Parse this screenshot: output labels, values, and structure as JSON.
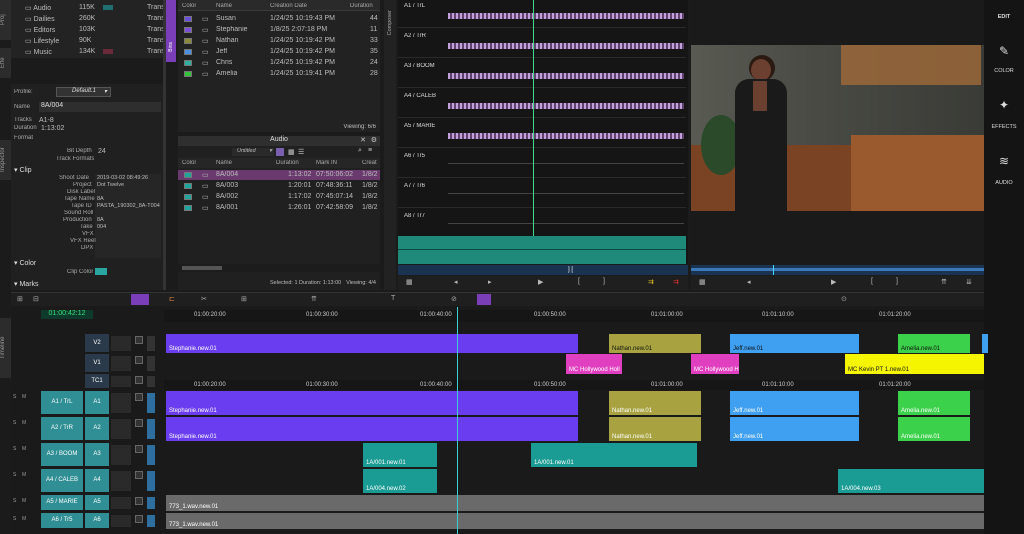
{
  "bins": {
    "items": [
      {
        "name": "Audio",
        "size": "115K",
        "type": "Trans"
      },
      {
        "name": "Dailies",
        "size": "260K",
        "type": "Trans"
      },
      {
        "name": "Editors",
        "size": "103K",
        "type": "Trans"
      },
      {
        "name": "Lifestyle",
        "size": "90K",
        "type": "Trans"
      },
      {
        "name": "Music",
        "size": "134K",
        "type": "Trans"
      }
    ]
  },
  "side_tabs": {
    "project": "Proj",
    "effects": "Effe",
    "inspector": "Inspector",
    "bins": "Bins",
    "composer": "Composer",
    "timeline": "Timeline"
  },
  "inspector": {
    "profile_label": "Profile:",
    "profile_value": "Default.1",
    "name_label": "Name",
    "name": "8A/004",
    "tracks_label": "Tracks",
    "tracks": "A1-8",
    "duration_label": "Duration",
    "duration": "1:13:02",
    "format_label": "Format",
    "bit_depth_label": "Bit Depth",
    "bit_depth": "24",
    "track_formats_label": "Track Formats",
    "clip_section": "Clip",
    "fields": [
      {
        "label": "Shoot Date",
        "value": "2019-03-02 08:49:26"
      },
      {
        "label": "Project",
        "value": "Dot Twelve"
      },
      {
        "label": "Disk Label",
        "value": ""
      },
      {
        "label": "Tape Name",
        "value": "8A"
      },
      {
        "label": "Tape ID",
        "value": "PASTA_190302_8A-T004"
      },
      {
        "label": "Sound Roll",
        "value": ""
      },
      {
        "label": "Production",
        "value": "8A"
      },
      {
        "label": "Take",
        "value": "004"
      },
      {
        "label": "VFX",
        "value": ""
      },
      {
        "label": "VFX Reel",
        "value": ""
      },
      {
        "label": "DPX",
        "value": ""
      }
    ],
    "color_section": "Color",
    "clip_color_label": "Clip Color",
    "marks_section": "Marks"
  },
  "users_bin": {
    "columns": [
      "Color",
      "Name",
      "Creation Date",
      "Duration"
    ],
    "rows": [
      {
        "color": "#6a4fdc",
        "name": "Susan",
        "date": "1/24/25 10:19:43 PM",
        "dur": "44"
      },
      {
        "color": "#7b4fd6",
        "name": "Stephanie",
        "date": "1/8/25 2:07:18 PM",
        "dur": "11"
      },
      {
        "color": "#8a8a3a",
        "name": "Nathan",
        "date": "1/24/25 10:19:42 PM",
        "dur": "33"
      },
      {
        "color": "#4a8fe0",
        "name": "Jeff",
        "date": "1/24/25 10:19:42 PM",
        "dur": "35"
      },
      {
        "color": "#2fb0a0",
        "name": "Chris",
        "date": "1/24/25 10:19:42 PM",
        "dur": "24"
      },
      {
        "color": "#36c23a",
        "name": "Amelia",
        "date": "1/24/25 10:19:41 PM",
        "dur": "28"
      }
    ],
    "viewing": "Viewing: 6/6"
  },
  "audio_bin": {
    "title": "Audio",
    "view": "Untitled",
    "columns": [
      "Color",
      "Name",
      "Duration",
      "Mark IN",
      "Creat"
    ],
    "rows": [
      {
        "name": "8A/004",
        "dur": "1:13:02",
        "mark": "07:50:06:02",
        "creat": "1/8/2"
      },
      {
        "name": "8A/003",
        "dur": "1:20:01",
        "mark": "07:48:36:11",
        "creat": "1/8/2"
      },
      {
        "name": "8A/002",
        "dur": "1:17:02",
        "mark": "07:45:07:14",
        "creat": "1/8/2"
      },
      {
        "name": "8A/001",
        "dur": "1:26:01",
        "mark": "07:42:58:09",
        "creat": "1/8/2"
      }
    ],
    "status": "Selected: 1  Duration: 1:13:00",
    "viewing": "Viewing: 4/4"
  },
  "source_tracks": [
    "A1 / TrL",
    "A2 / TrR",
    "A3 / BOOM",
    "A4 / CALEB",
    "A5 / MARIE",
    "A6 / Tr5",
    "A7 / Tr6",
    "A8 / Tr7"
  ],
  "right_nav": [
    {
      "label": "EDIT"
    },
    {
      "label": "COLOR"
    },
    {
      "label": "EFFECTS"
    },
    {
      "label": "AUDIO"
    }
  ],
  "timecode": "01:00:42:12",
  "ruler_top": [
    "01:00:20:00",
    "01:00:30:00",
    "01:00:40:00",
    "01:00:50:00",
    "01:01:00:00",
    "01:01:10:00",
    "01:01:20:00"
  ],
  "ruler_mid": [
    "01:00:20:00",
    "01:00:30:00",
    "01:00:40:00",
    "01:00:50:00",
    "01:01:00:00",
    "01:01:10:00",
    "01:01:20:00"
  ],
  "timeline_tracks": [
    {
      "name": "",
      "id": "V2"
    },
    {
      "name": "",
      "id": "V1"
    },
    {
      "name": "",
      "id": "TC1"
    },
    {
      "name": "A1 / TrL",
      "id": "A1"
    },
    {
      "name": "A2 / TrR",
      "id": "A2"
    },
    {
      "name": "A3 / BOOM",
      "id": "A3"
    },
    {
      "name": "A4 / CALEB",
      "id": "A4"
    },
    {
      "name": "A5 / MARIE",
      "id": "A5"
    },
    {
      "name": "A6 / Tr5",
      "id": "A6"
    }
  ],
  "clips": {
    "stephanie_v": "Stephanie.new.01",
    "nathan_v": "Nathan.new.01",
    "jeff_v": "Jeff.new.01",
    "amelia_v": "Amelia.new.01",
    "mc1": "MC Hollywood Holl",
    "mc2": "MC Hollywood H",
    "mc3": "MC Kevin PT 1.new.01",
    "stephanie_a": "Stephanie.new.01",
    "nathan_a": "Nathan.new.01",
    "jeff_a": "Jeff.new.01",
    "amelia_a": "Amelia.new.01",
    "a3_1": "1A/001.new.01",
    "a3_2": "1A/001.new.01",
    "a4_1": "1A/004.new.02",
    "a4_2": "1A/004.new.03",
    "a5": "773_1.wav.new.01",
    "a6": "773_1.wav.new.01"
  }
}
